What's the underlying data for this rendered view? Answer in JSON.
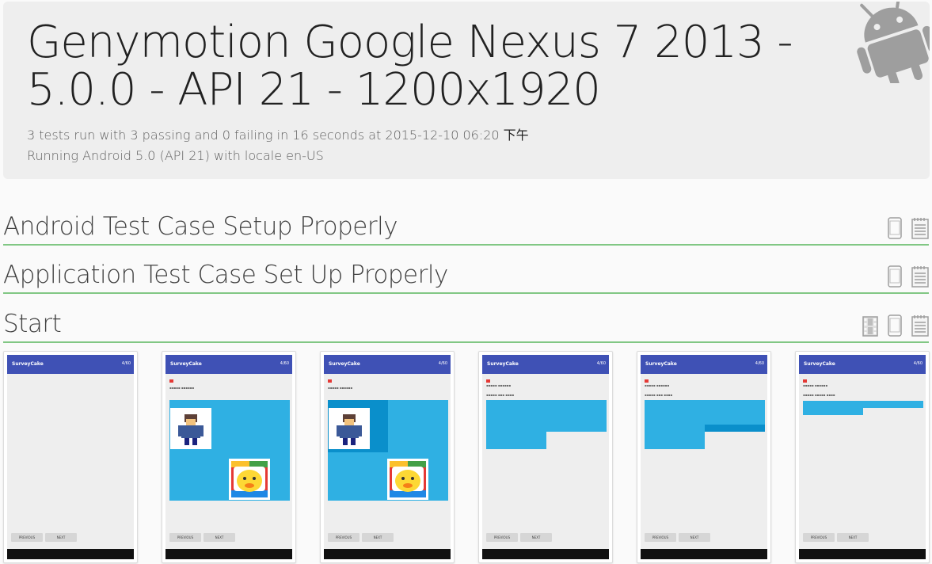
{
  "header": {
    "title": "Genymotion Google Nexus 7 2013 - 5.0.0 - API 21 - 1200x1920",
    "summary": "3 tests run with 3 passing and 0 failing in 16 seconds at 2015-12-10 06:20",
    "summary_suffix": "下午",
    "device_info": "Running Android 5.0 (API 21) with locale en-US",
    "logo_icon": "android-robot-icon"
  },
  "tests": [
    {
      "title": "Android Test Case Setup Properly",
      "status": "passed",
      "icons": [
        "device-icon",
        "log-icon"
      ]
    },
    {
      "title": "Application Test Case Set Up Properly",
      "status": "passed",
      "icons": [
        "device-icon",
        "log-icon"
      ]
    },
    {
      "title": "Start",
      "status": "passed",
      "icons": [
        "film-icon",
        "device-icon",
        "log-icon"
      ]
    }
  ],
  "screenshots": {
    "app_title": "SurveyCake",
    "app_right": "4/60",
    "prev_label": "PREVIOUS",
    "next_label": "NEXT",
    "items": [
      {
        "label": "screenshot-1",
        "kind": "blank"
      },
      {
        "label": "screenshot-2",
        "kind": "image-choice"
      },
      {
        "label": "screenshot-3",
        "kind": "image-choice-selected"
      },
      {
        "label": "screenshot-4",
        "kind": "grid-choice"
      },
      {
        "label": "screenshot-5",
        "kind": "grid-choice-selected"
      },
      {
        "label": "screenshot-6",
        "kind": "two-option"
      }
    ]
  },
  "colors": {
    "accent_green": "#81c784",
    "appbar_indigo": "#3f51b5",
    "choice_blue": "#2fb0e3"
  }
}
